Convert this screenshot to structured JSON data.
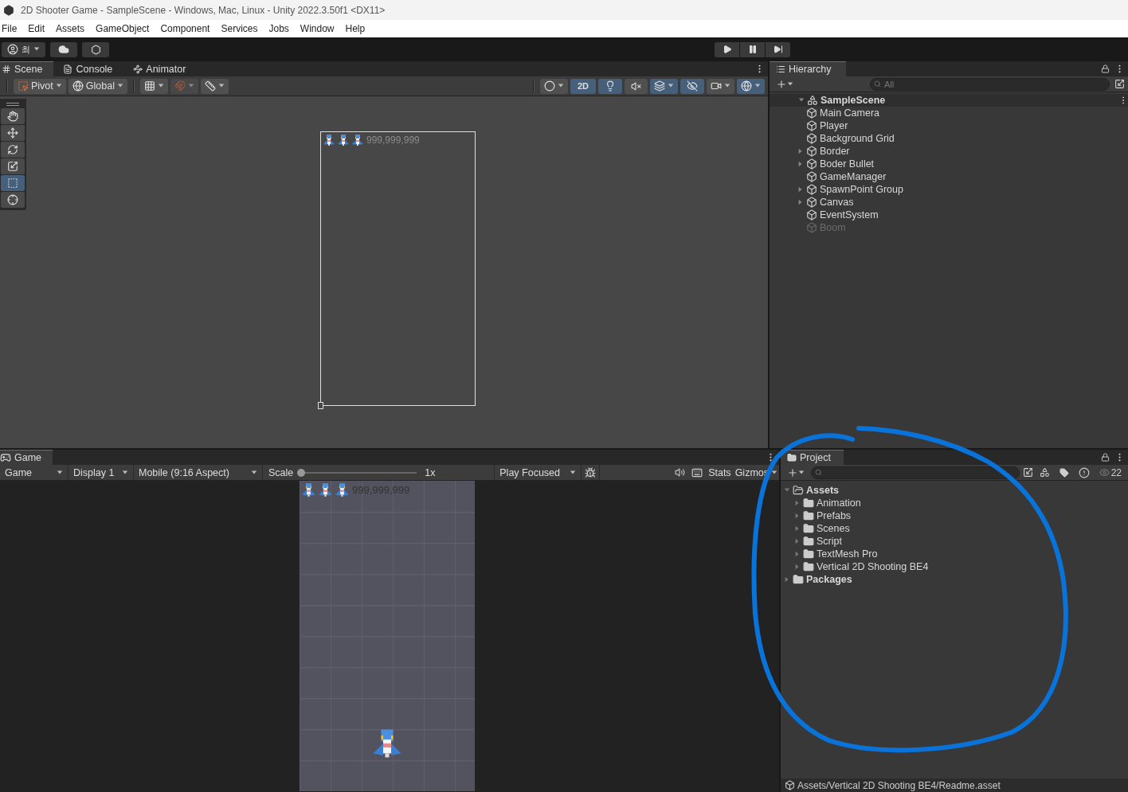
{
  "window": {
    "title": "2D Shooter Game - SampleScene - Windows, Mac, Linux - Unity 2022.3.50f1 <DX11>"
  },
  "menu": [
    "File",
    "Edit",
    "Assets",
    "GameObject",
    "Component",
    "Services",
    "Jobs",
    "Window",
    "Help"
  ],
  "main_toolbar": {
    "account_initial": "최",
    "play_controls": [
      {
        "kind": "play",
        "on": false
      },
      {
        "kind": "pause",
        "on": false
      },
      {
        "kind": "step",
        "on": false
      }
    ]
  },
  "scene_panel": {
    "tabs": [
      {
        "kind": "scene",
        "label": "Scene",
        "selected": true
      },
      {
        "kind": "console",
        "label": "Console",
        "selected": false
      },
      {
        "kind": "animator",
        "label": "Animator",
        "selected": false
      }
    ],
    "toolbar_left": [
      {
        "kind": "pivot",
        "label": "Pivot"
      },
      {
        "kind": "global",
        "label": "Global"
      },
      {
        "kind": "grid"
      },
      {
        "kind": "snap"
      },
      {
        "kind": "increment"
      }
    ],
    "toolbar_right": [
      {
        "kind": "shading",
        "on": false
      },
      {
        "kind": "dimension",
        "label": "2D",
        "on": true
      },
      {
        "kind": "lighting",
        "on": true
      },
      {
        "kind": "audio",
        "on": false
      },
      {
        "kind": "effects",
        "on": true
      },
      {
        "kind": "visibility",
        "on": true
      },
      {
        "kind": "camera",
        "on": false
      },
      {
        "kind": "gizmos",
        "on": true
      }
    ],
    "tools": [
      {
        "kind": "view",
        "selected": false
      },
      {
        "kind": "move",
        "selected": false
      },
      {
        "kind": "rotate",
        "selected": false
      },
      {
        "kind": "scale",
        "selected": false
      },
      {
        "kind": "rect",
        "selected": true
      },
      {
        "kind": "transform",
        "selected": false
      }
    ],
    "canvas": {
      "score": "999,999,999"
    }
  },
  "game_panel": {
    "tabs": [
      {
        "label": "Game",
        "selected": true
      }
    ],
    "toolbar": {
      "mode": "Game",
      "display": "Display 1",
      "aspect": "Mobile (9:16 Aspect)",
      "scale_label": "Scale",
      "scale": {
        "level": 0
      },
      "scale_reading": "1x",
      "play_mode": "Play Focused",
      "stats": "Stats",
      "gizmos": "Gizmos"
    },
    "score": "999,999,999"
  },
  "hierarchy": {
    "tabs": [
      {
        "label": "Hierarchy",
        "selected": true
      }
    ],
    "search": {
      "placeholder": "All"
    },
    "scene": {
      "label": "SampleScene",
      "expanded": true,
      "children": [
        {
          "label": "Main Camera",
          "active": true
        },
        {
          "label": "Player",
          "active": true
        },
        {
          "label": "Background Grid",
          "active": true
        },
        {
          "label": "Border",
          "active": true,
          "expanded": false
        },
        {
          "label": "Boder Bullet",
          "active": true,
          "expanded": false
        },
        {
          "label": "GameManager",
          "active": true
        },
        {
          "label": "SpawnPoint Group",
          "active": true,
          "expanded": false
        },
        {
          "label": "Canvas",
          "active": true,
          "expanded": false
        },
        {
          "label": "EventSystem",
          "active": true
        },
        {
          "label": "Boom",
          "active": false
        }
      ]
    }
  },
  "project": {
    "tabs": [
      {
        "label": "Project",
        "selected": true
      }
    ],
    "hidden_count": "22",
    "tree": [
      {
        "label": "Assets",
        "expanded": true,
        "children": [
          {
            "label": "Animation",
            "expanded": false
          },
          {
            "label": "Prefabs",
            "expanded": false
          },
          {
            "label": "Scenes",
            "expanded": false
          },
          {
            "label": "Script",
            "expanded": false
          },
          {
            "label": "TextMesh Pro",
            "expanded": false
          },
          {
            "label": "Vertical 2D Shooting BE4",
            "expanded": false
          }
        ]
      },
      {
        "label": "Packages",
        "expanded": false
      }
    ],
    "status": "Assets/Vertical 2D Shooting BE4/Readme.asset"
  }
}
